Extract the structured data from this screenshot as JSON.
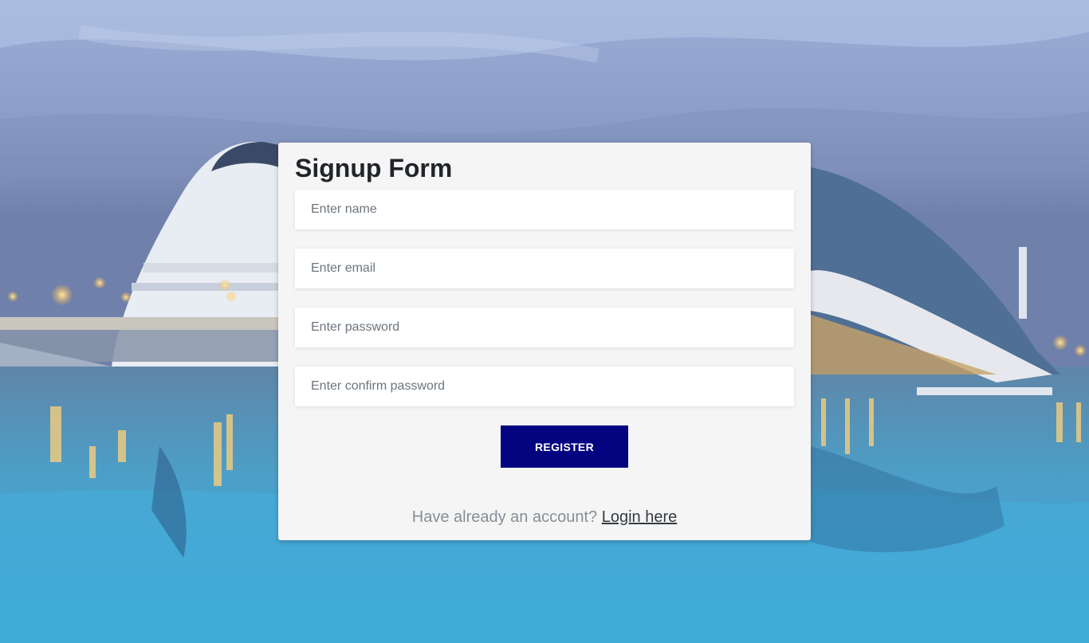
{
  "form": {
    "title": "Signup Form",
    "name_placeholder": "Enter name",
    "email_placeholder": "Enter email",
    "password_placeholder": "Enter password",
    "confirm_password_placeholder": "Enter confirm password",
    "register_label": "REGISTER",
    "footer_text": "Have already an account?",
    "login_link_label": "Login here"
  },
  "colors": {
    "button": "#040481",
    "card": "#f5f5f5"
  }
}
